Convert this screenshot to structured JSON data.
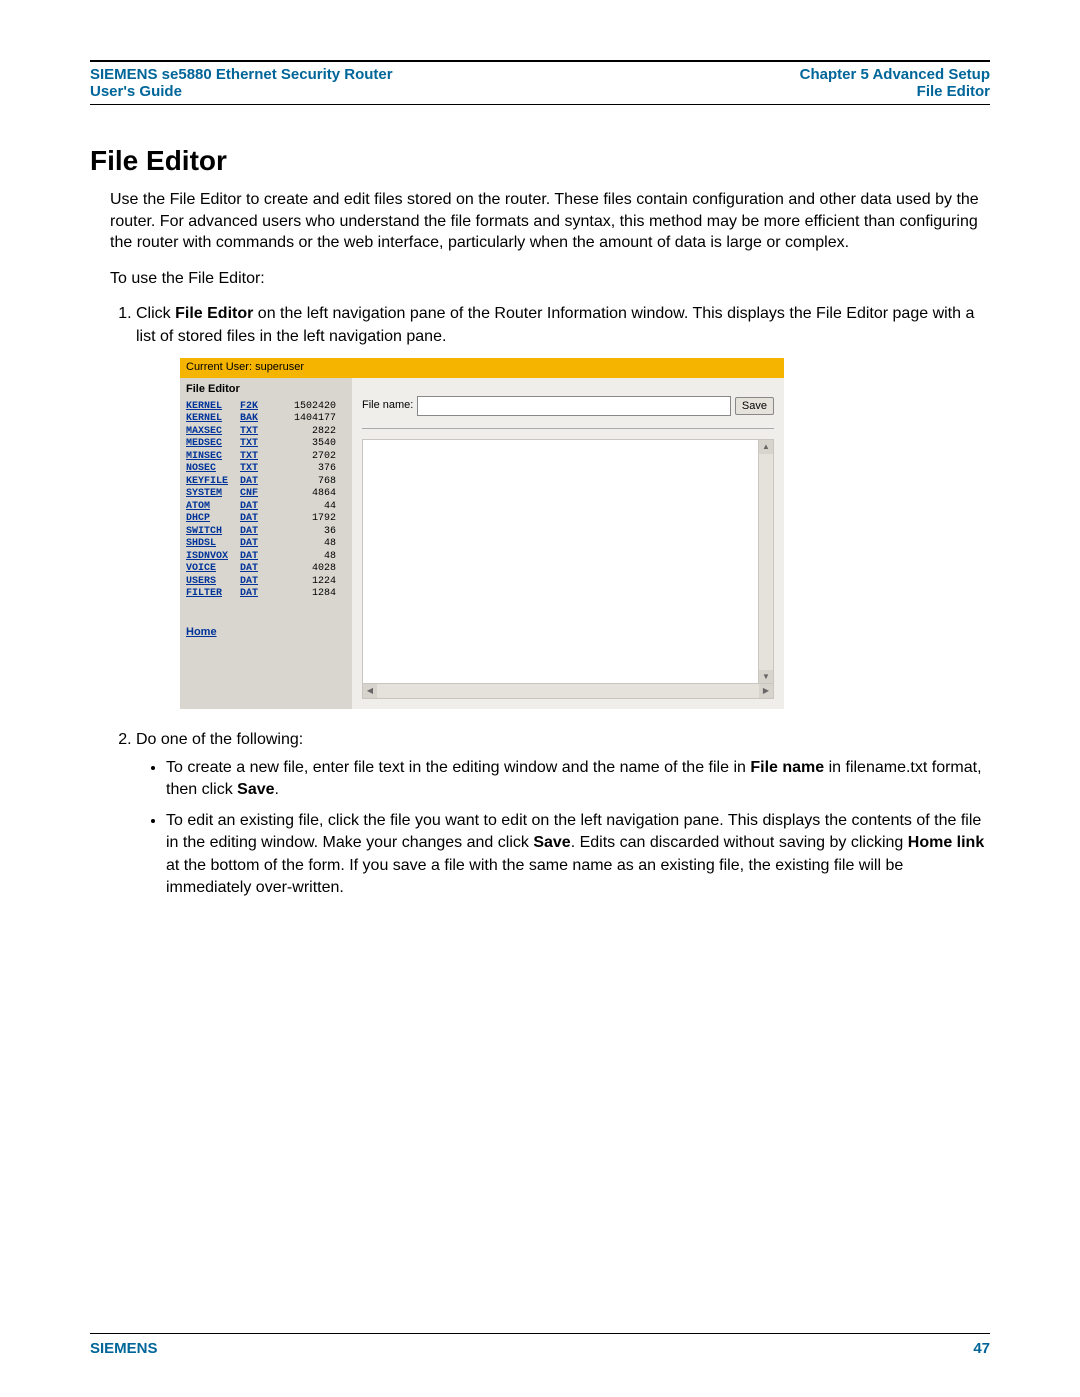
{
  "header": {
    "left_line1": "SIEMENS se5880 Ethernet Security Router",
    "left_line2": "User's Guide",
    "right_line1": "Chapter 5  Advanced Setup",
    "right_line2": "File Editor"
  },
  "title": "File Editor",
  "intro": "Use the File Editor to create and edit files stored on the router. These files contain configuration and other data used by the router. For advanced users who understand the file formats and syntax, this method may be more efficient than configuring the router with commands or the web interface, particularly when the amount of data is large or complex.",
  "to_use": "To use the File Editor:",
  "step1_pre": "Click ",
  "step1_b": "File Editor",
  "step1_post": " on the left navigation pane of the Router Information window. This displays the File Editor page with a list of stored files in the left navigation pane.",
  "step2_lead": "Do one of the following:",
  "step2a_pre": "To create a new file, enter file text in the editing window and the name of the file in ",
  "step2a_b1": "File name",
  "step2a_mid": " in filename.txt format, then click ",
  "step2a_b2": "Save",
  "step2a_post": ".",
  "step2b_pre": "To edit an existing file, click the file you want to edit on the left navigation pane. This displays the contents of the file in the editing window. Make your changes and click ",
  "step2b_b1": "Save",
  "step2b_mid": ". Edits can discarded without saving by clicking ",
  "step2b_b2": "Home link",
  "step2b_post": " at the bottom of the form. If you save a file with the same name as an existing file, the existing file will be immediately over-written.",
  "screenshot": {
    "topbar": "Current User: superuser",
    "side_title": "File Editor",
    "files": [
      {
        "name": "KERNEL",
        "ext": "F2K",
        "size": "1502420"
      },
      {
        "name": "KERNEL",
        "ext": "BAK",
        "size": "1404177"
      },
      {
        "name": "MAXSEC",
        "ext": "TXT",
        "size": "2822"
      },
      {
        "name": "MEDSEC",
        "ext": "TXT",
        "size": "3540"
      },
      {
        "name": "MINSEC",
        "ext": "TXT",
        "size": "2702"
      },
      {
        "name": "NOSEC",
        "ext": "TXT",
        "size": "376"
      },
      {
        "name": "KEYFILE",
        "ext": "DAT",
        "size": "768"
      },
      {
        "name": "SYSTEM",
        "ext": "CNF",
        "size": "4864"
      },
      {
        "name": "ATOM",
        "ext": "DAT",
        "size": "44"
      },
      {
        "name": "DHCP",
        "ext": "DAT",
        "size": "1792"
      },
      {
        "name": "SWITCH",
        "ext": "DAT",
        "size": "36"
      },
      {
        "name": "SHDSL",
        "ext": "DAT",
        "size": "48"
      },
      {
        "name": "ISDNVOX",
        "ext": "DAT",
        "size": "48"
      },
      {
        "name": "VOICE",
        "ext": "DAT",
        "size": "4028"
      },
      {
        "name": "USERS",
        "ext": "DAT",
        "size": "1224"
      },
      {
        "name": "FILTER",
        "ext": "DAT",
        "size": "1284"
      }
    ],
    "home": "Home",
    "filename_label": "File name:",
    "save_label": "Save"
  },
  "footer": {
    "left": "SIEMENS",
    "right": "47"
  }
}
